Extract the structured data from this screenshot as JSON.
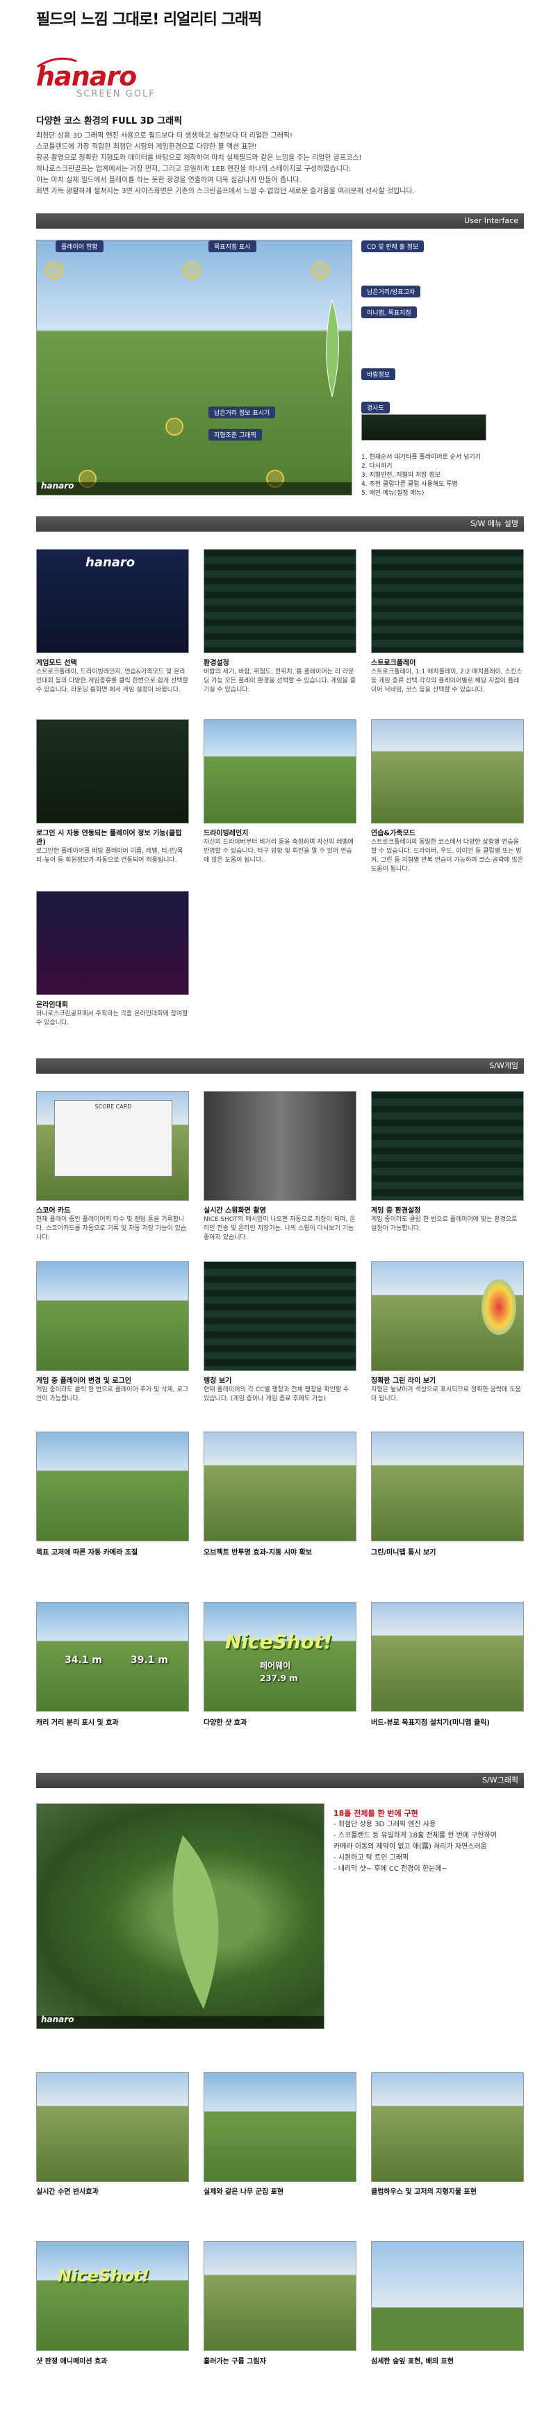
{
  "headline": "필드의 느낌 그대로! 리얼리티 그래픽",
  "brand": {
    "name": "hanaro",
    "sub": "SCREEN GOLF"
  },
  "intro": {
    "title": "다양한 코스 환경의 FULL 3D 그래픽",
    "lines": [
      "최첨단 상용 3D 그래픽 엔진 사용으로 필드보다 더 생생하고 실전보다 더 리얼한 그래픽!",
      "스코틀랜드에 가장 적합한 최첨단 시탐의 게임환경으로 다양한 볼 액션 표현!",
      "항공 촬영으로 정확한 지형도와 데이터를 바탕으로 제작하여 마치 실제필드와 같은 느낌을 주는 리얼한 골프코스!",
      "하나로스크린골프는 업계에서는 가장 먼저, 그리고 유일하게 1EB 엔진을 하나의 스테이지로 구성하였습니다.",
      "이는 마치 실제 필드에서 플레이를 하는 듯한 광경을 연출하여 더욱 실감나게 만들어 줍니다.",
      "화면 가득 광활하게 펼쳐지는 3면 사이즈화면은 기존의 스크린골프에서 느낄 수 없었던 새로운 즐거움을 여러분께 선사할 것입니다."
    ]
  },
  "bars": {
    "ui": "User Interface",
    "menu": "S/W 메뉴 설명",
    "game": "S/W게임",
    "graphic": "S/W그래픽"
  },
  "ui_callouts": {
    "player": "플레이어 현황",
    "target": "목표지점 표시",
    "cd": "CD 및 판례 홀 정보",
    "wind": "남은거리/방표고차",
    "mini": "미니맵, 목표지점",
    "info": "바람정보",
    "slope": "경사도",
    "distance": "남은거리 정보 표시기",
    "aim": "지형조준 그래픽"
  },
  "ui_notes": [
    "1. 현재순서 대기타를 플레이어로 순서 넘기기",
    "2. 다시하기",
    "3. 지형반전, 지형의 저장 정보",
    "4. 추천 클럽다른 클럽 사용해도 투명",
    "5. 메인 메뉴(절정 메뉴)"
  ],
  "menu_items": [
    {
      "title": "게임모드 선택",
      "text": "스트로크플레이, 드라이빙레인지, 연습&가족모드 및 온라인대회 등의 다양한 게임종류를 클릭 한번으로 쉽게 선택할 수 있습니다. 라운딩 홈화면 에서 게임 설정이 바뀝니다."
    },
    {
      "title": "환경설정",
      "text": "바람의 세기, 바람, 위험도, 핀위치, 홈 플레이어는 리 라운딩 가능 모든 플레이 환경을 선택할 수 있습니다. 게임을 즐기실 수 있습니다."
    },
    {
      "title": "스트로크플레이",
      "text": "스트로크플레이, 1:1 매치플레이, 2:2 매치플레이, 스킨스 등 게임 종류 선택 각각의 플레이어별로 해당 지점이 플레이어 닉네임, 코스 등을 선택할 수 있습니다."
    },
    {
      "title": "로그인 시 자동 연동되는 플레이어 정보 기능(클럽관)",
      "text": "로그인한 플레이어를 바탕 플레이어 이름, 레벨, 티-번/목 티-높이 등 회원정보가 자동으로 연동되어 적용됩니다."
    },
    {
      "title": "드라이빙레인지",
      "text": "자신의 드라이버부터 비거리 등을 측정하며 자신의 레벨에 반영할 수 있습니다. 타구 방향 및 회전을 알 수 있어 연습에 많은 도움이 됩니다."
    },
    {
      "title": "연습&가족모드",
      "text": "스트로크플레이의 동일한 코스에서 다양한 상황별 연습을 할 수 있습니다. 드라이버, 우드, 아이언 등 클럽별 또는 벙커, 그린 등 지형별 반복 연습이 가능하며 코스 공략에 많은 도움이 됩니다."
    },
    {
      "title": "온라인대회",
      "text": "하나로스크린골프에서 주최하는 각종 온라인대회에 참여할 수 있습니다."
    }
  ],
  "game_items": [
    {
      "title": "스코어 카드",
      "text": "현재 플레이 중인 플레이어의 타수 및 랜덤 통을 기록합니다. 스코어카드를 자동으로 기록 및 자동 저장 기능이 있습니다."
    },
    {
      "title": "실시간 스윙화면 촬영",
      "text": "NICE SHOT의 매시업이 나오면 자동으로 저장이 되며, 온라인 전송 및 온라인 저장기능. 나의 스윙이 다시보기 기능 좋아지 있습니다."
    },
    {
      "title": "게임 중 환경설정",
      "text": "게임 중이라도 클럽 한 번으로 플레이어에 맞는 환경으로 설정이 가능합니다."
    },
    {
      "title": "게임 중 플레이어 변경 및 로그인",
      "text": "게임 중이라도 클릭 한 번으로 플레이어 추가 및 삭제, 로그인이 가능합니다."
    },
    {
      "title": "팽창 보기",
      "text": "현재 플레이어의 각 CC별 팽창과 전체 팽창을 확인할 수 있습니다. (게임 중이나 게임 종료 후에도 가능)"
    },
    {
      "title": "정확한 그린 라이 보기",
      "text": "지형은 높낮이가 색상으로 표시되므로 정확한 공략에 도움이 됩니다."
    },
    {
      "title": "목표 고저에 따른 자동 카메라 조절",
      "text": ""
    },
    {
      "title": "오브젝트 반투명 효과-지동 시야 확보",
      "text": ""
    },
    {
      "title": "그린/미니맵 통시 보기",
      "text": ""
    },
    {
      "title": "캐리 거리 분리 표시 및 효과",
      "text": ""
    },
    {
      "title": "다양한 샷 효과",
      "text": ""
    },
    {
      "title": "버드-뷰로 목표지점 설치기(미니맵 클릭)",
      "text": ""
    }
  ],
  "shot_texts": {
    "nice": "NiceShot!",
    "fairway": "페어웨이",
    "dist1": "237.9 m",
    "carry1": "34.1 m",
    "carry2": "39.1 m",
    "score": "SCORE CARD",
    "nice2": "NiceShot!"
  },
  "graphic_feature": {
    "title": "18홀 전체를 한 번에 구현",
    "lines": [
      "- 최첨단 상용 3D 그래픽 엔진 사용",
      "- 스코틀랜드 등 유일하게 18홀 전체를 한 번에 구현하여",
      "  카메라 이동의 제약이 없고 애(露) 처리가 자연스러움",
      "- 시원하고 탁 트인 그래픽",
      "- 내리막 샷~ 후에 CC 전경이 한눈에~"
    ]
  },
  "graphic_items": [
    {
      "title": "실시간 수면 반사효과"
    },
    {
      "title": "실제와 같은 나무 군집 표현"
    },
    {
      "title": "클럽하우스 및 고저의 지형지물 표현"
    },
    {
      "title": "샷 판정 애니메이션 효과"
    },
    {
      "title": "흘러가는 구름 그림자"
    },
    {
      "title": "섬세한 숲잎 표현, 배의 표현"
    }
  ]
}
